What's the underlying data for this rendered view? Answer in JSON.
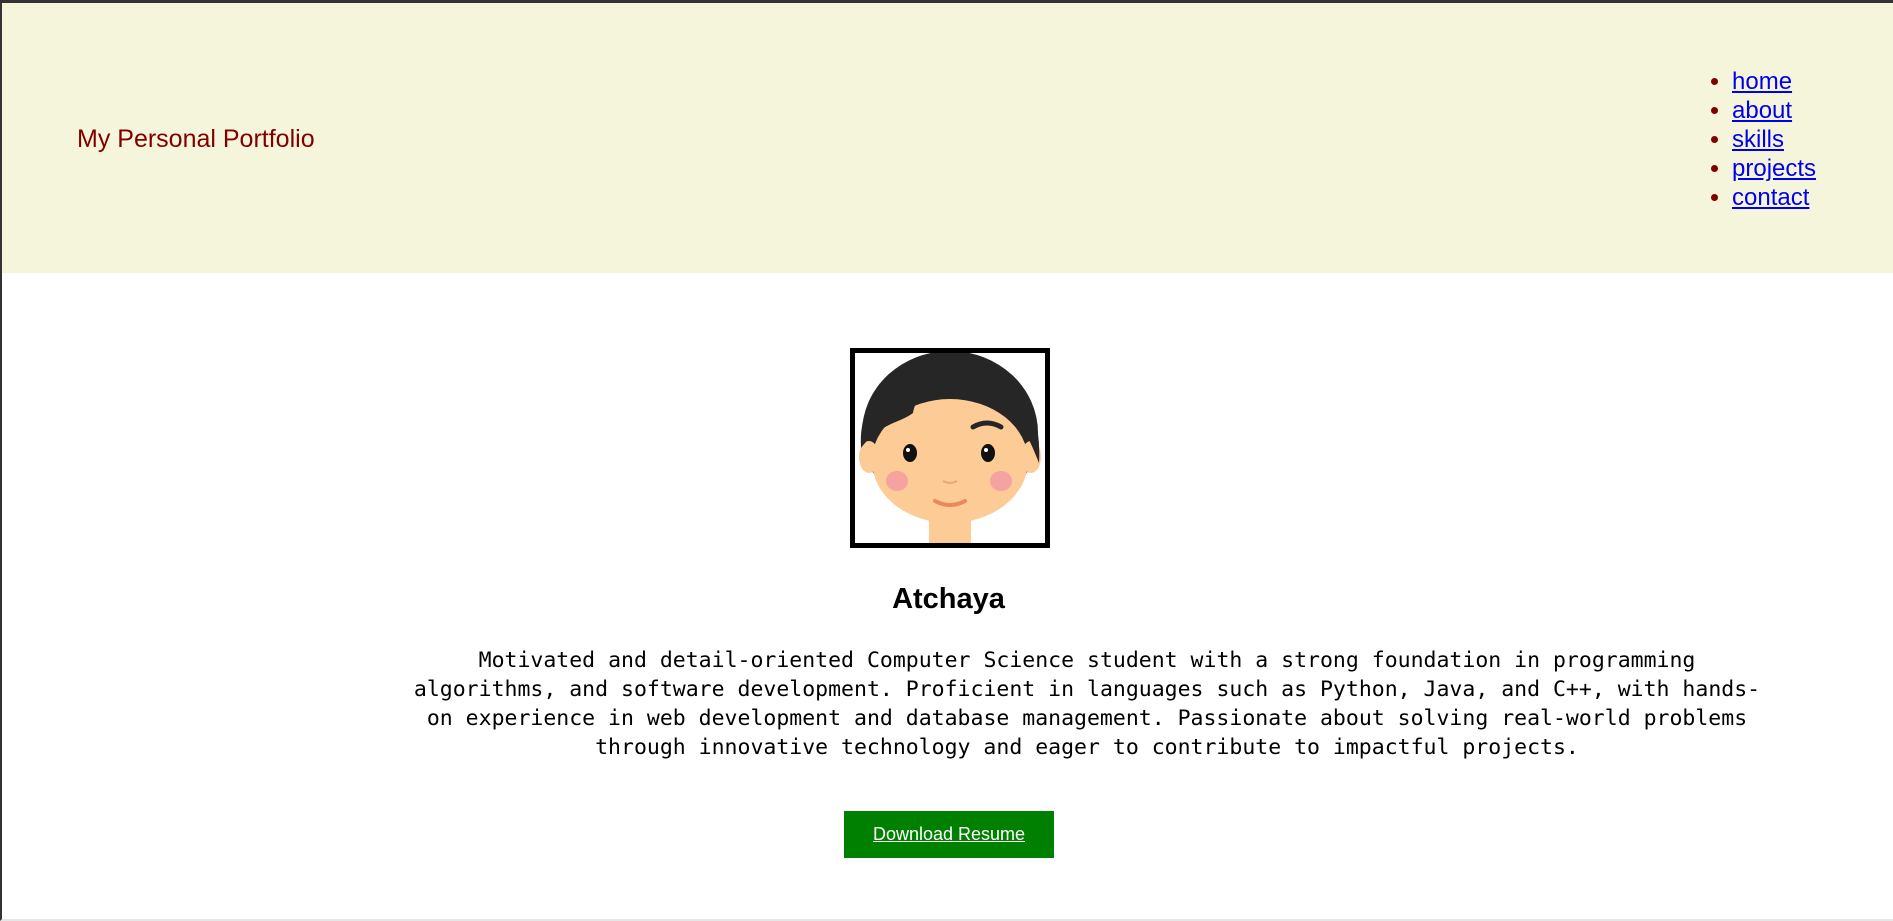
{
  "header": {
    "brand": "My Personal Portfolio",
    "nav": [
      {
        "label": "home"
      },
      {
        "label": "about"
      },
      {
        "label": "skills"
      },
      {
        "label": "projects"
      },
      {
        "label": "contact"
      }
    ]
  },
  "profile": {
    "avatar_icon": "cartoon-face-avatar",
    "name": "Atchaya",
    "bio": "Motivated and detail-oriented Computer Science student with a strong foundation in programming algorithms, and software development. Proficient in languages such as Python, Java, and C++, with hands-on experience in web development and database management. Passionate about solving real-world problems through innovative technology and eager to contribute to impactful projects.",
    "resume_button": "Download Resume"
  },
  "colors": {
    "header_bg": "#f5f5dc",
    "brand_text": "#800000",
    "link": "#0000ee",
    "button_bg": "#008000"
  }
}
